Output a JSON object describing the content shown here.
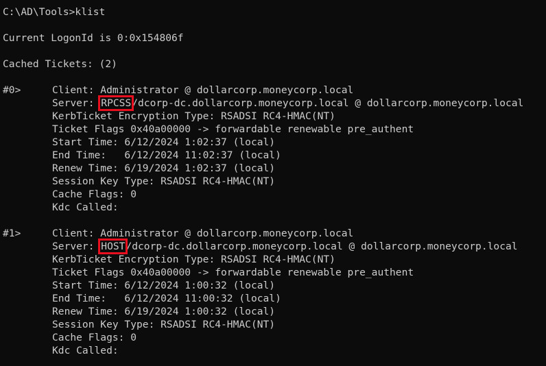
{
  "accent": "#e8101e",
  "prompt": "C:\\AD\\Tools>klist",
  "logon": "Current LogonId is 0:0x154806f",
  "cached": "Cached Tickets: (2)",
  "tickets": [
    {
      "index": "#0>",
      "client": "Client: Administrator @ dollarcorp.moneycorp.local",
      "server_prefix": "Server: ",
      "server_service": "RPCSS",
      "server_rest": "/dcorp-dc.dollarcorp.moneycorp.local @ dollarcorp.moneycorp.local",
      "enc": "KerbTicket Encryption Type: RSADSI RC4-HMAC(NT)",
      "flags": "Ticket Flags 0x40a00000 -> forwardable renewable pre_authent",
      "start": "Start Time: 6/12/2024 1:02:37 (local)",
      "end": "End Time:   6/12/2024 11:02:37 (local)",
      "renew": "Renew Time: 6/19/2024 1:02:37 (local)",
      "session": "Session Key Type: RSADSI RC4-HMAC(NT)",
      "cache": "Cache Flags: 0",
      "kdc": "Kdc Called:"
    },
    {
      "index": "#1>",
      "client": "Client: Administrator @ dollarcorp.moneycorp.local",
      "server_prefix": "Server: ",
      "server_service": "HOST",
      "server_rest": "/dcorp-dc.dollarcorp.moneycorp.local @ dollarcorp.moneycorp.local",
      "enc": "KerbTicket Encryption Type: RSADSI RC4-HMAC(NT)",
      "flags": "Ticket Flags 0x40a00000 -> forwardable renewable pre_authent",
      "start": "Start Time: 6/12/2024 1:00:32 (local)",
      "end": "End Time:   6/12/2024 11:00:32 (local)",
      "renew": "Renew Time: 6/19/2024 1:00:32 (local)",
      "session": "Session Key Type: RSADSI RC4-HMAC(NT)",
      "cache": "Cache Flags: 0",
      "kdc": "Kdc Called:"
    }
  ]
}
